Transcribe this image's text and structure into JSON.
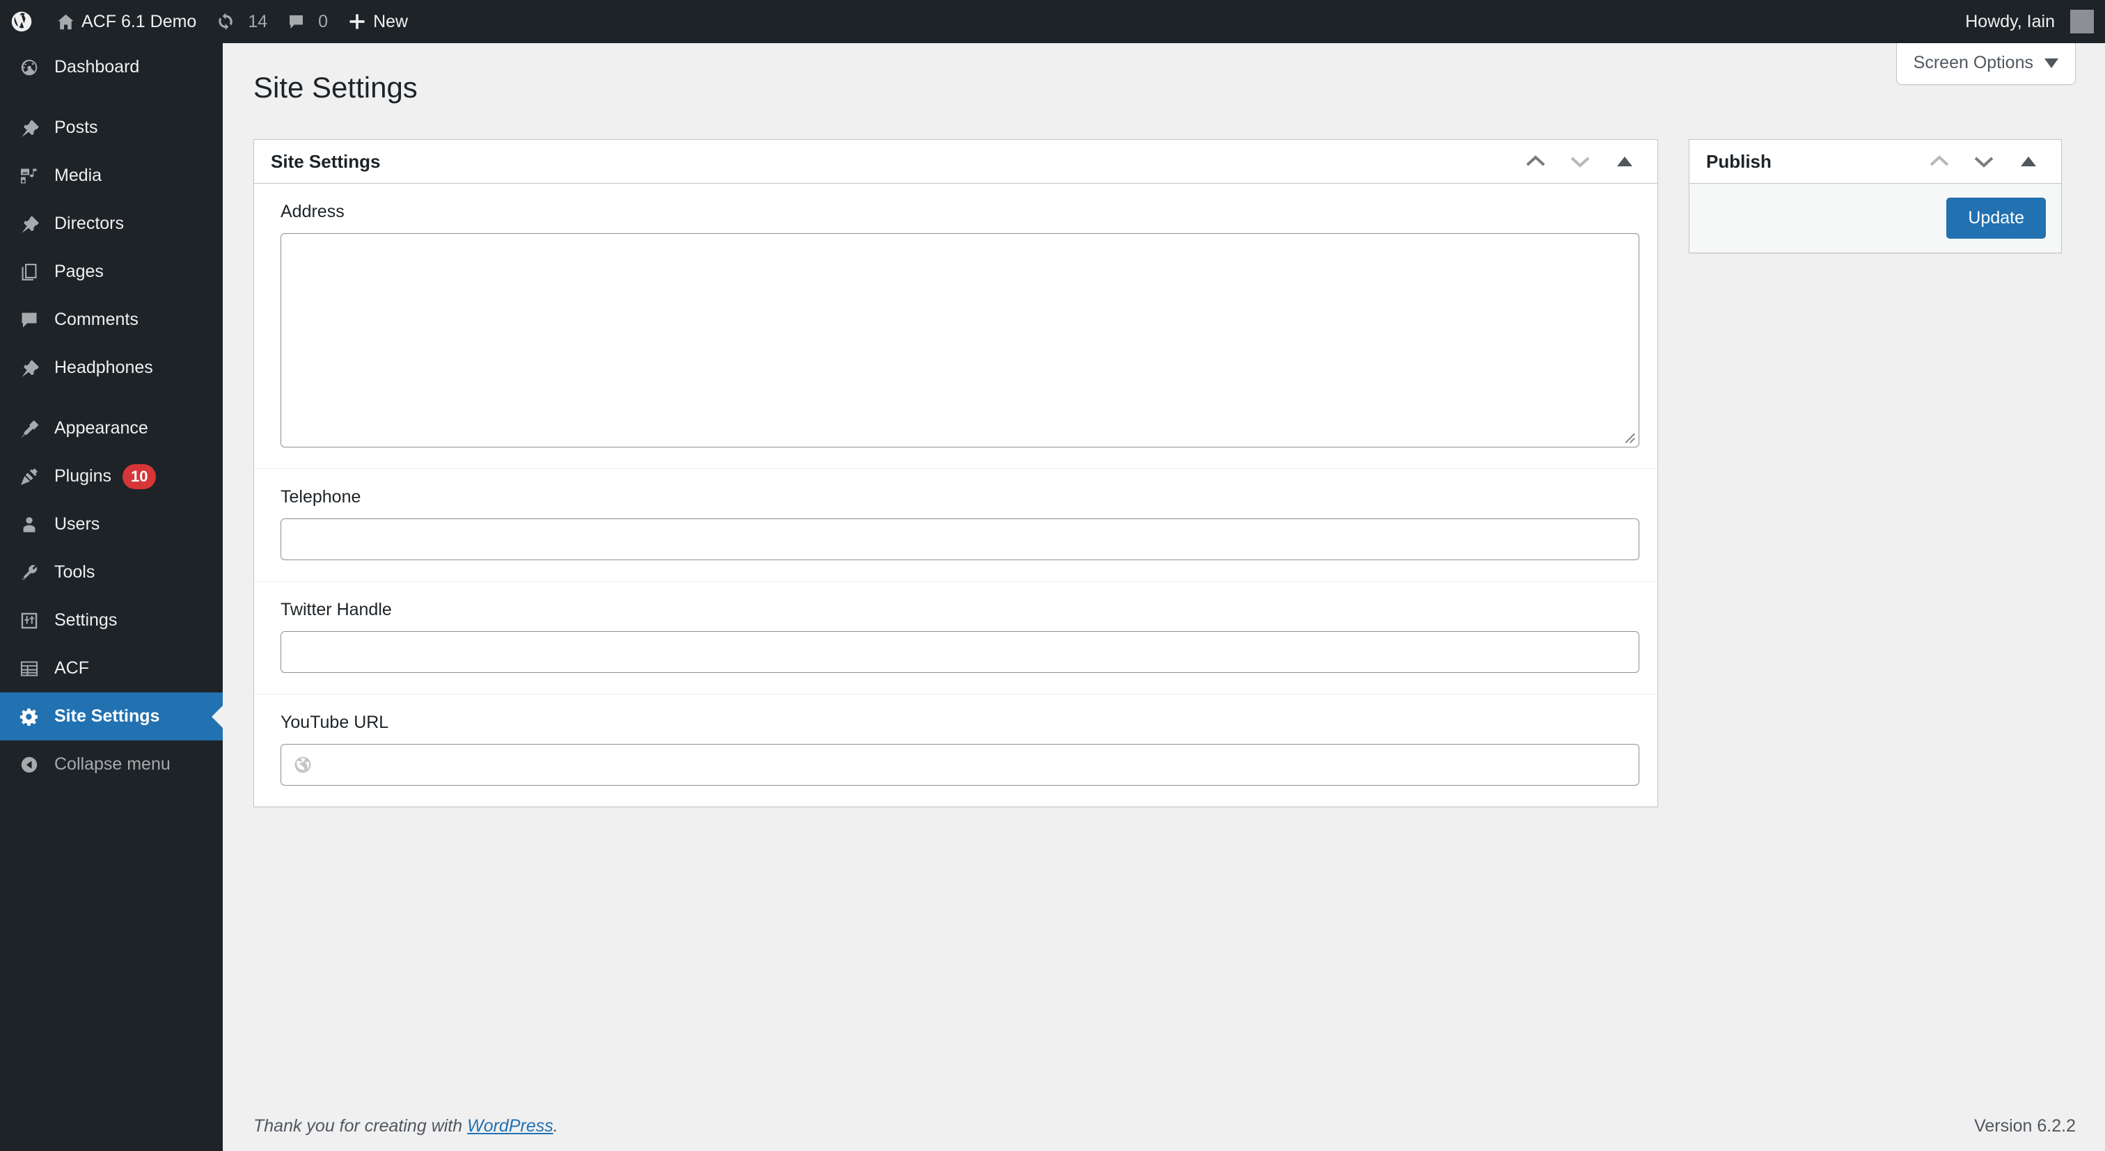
{
  "adminbar": {
    "logo_icon": "wordpress-logo-icon",
    "site_name": "ACF 6.1 Demo",
    "site_icon": "home-icon",
    "updates_icon": "updates-icon",
    "updates_count": "14",
    "comments_icon": "comment-bubble-icon",
    "comments_count": "0",
    "new_icon": "plus-icon",
    "new_label": "New",
    "howdy": "Howdy, Iain",
    "avatar_icon": "avatar-icon"
  },
  "sidebar": {
    "items": [
      {
        "label": "Dashboard",
        "icon": "dashboard-icon",
        "active": false
      },
      {
        "label": "Posts",
        "icon": "pin-icon",
        "active": false
      },
      {
        "label": "Media",
        "icon": "media-icon",
        "active": false
      },
      {
        "label": "Directors",
        "icon": "pin-icon",
        "active": false
      },
      {
        "label": "Pages",
        "icon": "pages-icon",
        "active": false
      },
      {
        "label": "Comments",
        "icon": "comment-bubble-icon",
        "active": false
      },
      {
        "label": "Headphones",
        "icon": "pin-icon",
        "active": false
      },
      {
        "label": "Appearance",
        "icon": "paintbrush-icon",
        "active": false
      },
      {
        "label": "Plugins",
        "icon": "plugin-icon",
        "active": false,
        "badge": "10"
      },
      {
        "label": "Users",
        "icon": "user-icon",
        "active": false
      },
      {
        "label": "Tools",
        "icon": "wrench-icon",
        "active": false
      },
      {
        "label": "Settings",
        "icon": "settings-sliders-icon",
        "active": false
      },
      {
        "label": "ACF",
        "icon": "acf-icon",
        "active": false
      },
      {
        "label": "Site Settings",
        "icon": "gear-icon",
        "active": true
      }
    ],
    "collapse_label": "Collapse menu",
    "collapse_icon": "collapse-arrow-icon",
    "active_color": "#2271b1",
    "badge_color": "#d63638",
    "background": "#1d2327"
  },
  "screen_options": {
    "label": "Screen Options",
    "caret_icon": "caret-down-icon"
  },
  "page": {
    "title": "Site Settings"
  },
  "postbox": {
    "title": "Site Settings",
    "order_higher_icon": "chevron-up-icon",
    "order_lower_icon": "chevron-down-icon",
    "toggle_icon": "triangle-up-icon",
    "fields": [
      {
        "label": "Address",
        "type": "textarea",
        "value": "",
        "placeholder": ""
      },
      {
        "label": "Telephone",
        "type": "text",
        "value": "",
        "placeholder": ""
      },
      {
        "label": "Twitter Handle",
        "type": "text",
        "value": "",
        "placeholder": ""
      },
      {
        "label": "YouTube URL",
        "type": "url",
        "value": "",
        "placeholder": "",
        "icon": "globe-icon"
      }
    ]
  },
  "publish": {
    "title": "Publish",
    "order_higher_icon": "chevron-up-icon",
    "order_lower_icon": "chevron-down-icon",
    "toggle_icon": "triangle-up-icon",
    "update_label": "Update",
    "button_color": "#2271b1"
  },
  "footer": {
    "thanks_prefix": "Thank you for creating with ",
    "wordpress_link": "WordPress",
    "thanks_suffix": ".",
    "version": "Version 6.2.2"
  }
}
